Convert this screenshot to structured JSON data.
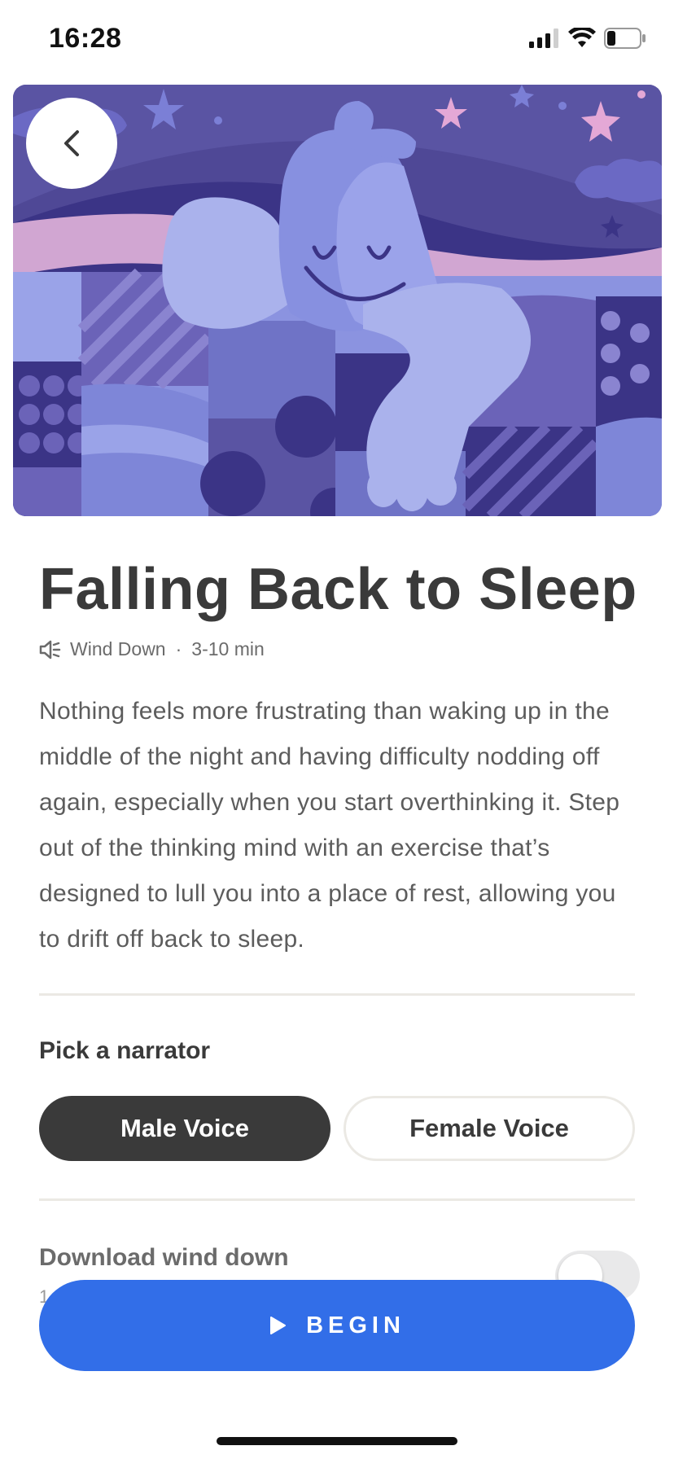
{
  "status_bar": {
    "time": "16:28",
    "icons": [
      "cellular-signal-icon",
      "wifi-icon",
      "battery-icon"
    ]
  },
  "hero": {
    "illustration": "sleeping-character-under-quilt",
    "back_icon": "chevron-left-icon"
  },
  "session": {
    "title": "Falling Back to Sleep",
    "meta_icon": "speaker-icon",
    "category": "Wind Down",
    "separator": "·",
    "duration": "3-10 min",
    "description": "Nothing feels more frustrating than waking up in the middle of the night and having difficulty nodding off again, especially when you start overthinking it. Step out of the thinking mind with an exercise that’s designed to lull you into a place of rest, allowing you to drift off back to sleep."
  },
  "narrator": {
    "heading": "Pick a narrator",
    "options": [
      {
        "label": "Male Voice",
        "selected": true
      },
      {
        "label": "Female Voice",
        "selected": false
      }
    ]
  },
  "download": {
    "label": "Download wind down",
    "subtext": "1",
    "enabled": false
  },
  "actions": {
    "begin_label": "BEGIN",
    "begin_icon": "play-icon"
  },
  "colors": {
    "primary": "#326ee8",
    "text_dark": "#3a3a3a",
    "divider": "#ebe9e4",
    "hero_bg": "#4f4896"
  }
}
